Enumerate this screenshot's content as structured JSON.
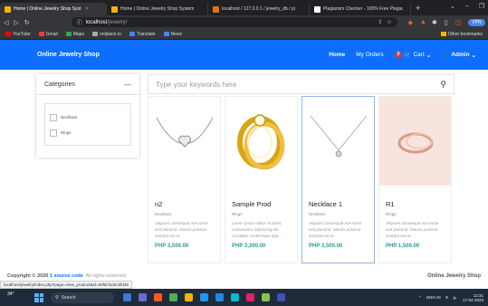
{
  "browser": {
    "tabs": [
      {
        "title": "Home | Online Jewelry Shop Syst",
        "color": "#f4b400",
        "active": true
      },
      {
        "title": "Home | Online Jewelry Shop System",
        "color": "#f4b400",
        "active": false
      },
      {
        "title": "localhost / 127.0.0.1 / jewelry_db / pi",
        "color": "#e8710a",
        "active": false
      },
      {
        "title": "Plagiarism Checker - 100% Free Plagia",
        "color": "#ffffff",
        "active": false
      }
    ],
    "new_tab": "+",
    "address": {
      "host": "localhost",
      "path": "/jewelry/"
    },
    "vpn": "VPN",
    "bookmarks": [
      {
        "label": "YouTube",
        "color": "#ff0000"
      },
      {
        "label": "Gmail",
        "color": "#ea4335"
      },
      {
        "label": "Maps",
        "color": "#34a853"
      },
      {
        "label": "oniplace.in",
        "color": "#aaaaaa"
      },
      {
        "label": "Translate",
        "color": "#4285f4"
      },
      {
        "label": "News",
        "color": "#4285f4"
      }
    ],
    "other_bookmarks": "Other bookmarks"
  },
  "site": {
    "brand": "Online Jewelry Shop",
    "nav": {
      "home": "Home",
      "orders": "My Orders",
      "cart": "Cart",
      "cart_count": "0",
      "admin": "Admin"
    },
    "categories": {
      "title": "Categories",
      "items": [
        "Necklace",
        "Rings"
      ]
    },
    "search_placeholder": "Type your keywords here",
    "products": [
      {
        "name": "n2",
        "category": "Necklace",
        "desc": "Aliquam consequat non tortor sed placerat. Mauris pulvinar suscipit est et...",
        "price": "PHP 3,500.00",
        "image": "necklace-heart-silver"
      },
      {
        "name": "Sample Prod",
        "category": "Rings",
        "desc": "Lorem ipsum dolor sit amet, consectetur adipiscing elit. Curabitur scelerisque ege...",
        "price": "PHP 3,300.00",
        "image": "gold-ring-set"
      },
      {
        "name": "Necklace 1",
        "category": "Necklace",
        "desc": "Aliquam consequat non tortor sed placerat. Mauris pulvinar suscipit est et...",
        "price": "PHP 3,500.00",
        "image": "necklace-drop-silver"
      },
      {
        "name": "R1",
        "category": "Rings",
        "desc": "Aliquam consequat non tortor sed placerat. Mauris pulvinar suscipit est et...",
        "price": "PHP 1,500.00",
        "image": "rose-gold-ring"
      }
    ],
    "footer": {
      "copyright_prefix": "Copyright © 2020",
      "copyright_link": "1 source code",
      "copyright_suffix": ". All rights reserved.",
      "right": "Online Jewelry Shop"
    }
  },
  "status_url": "localhost/jewelry/index.php?page=view_product&id=b9fdcf1d2c6fd49",
  "taskbar": {
    "search": "Search",
    "weather": "34°",
    "tray_lang": "ENG IN",
    "time": "12:31",
    "date": "17-04-2023"
  },
  "colors": {
    "primary": "#0d6efd",
    "price": "#2b9a9a",
    "badge": "#dc3545"
  }
}
